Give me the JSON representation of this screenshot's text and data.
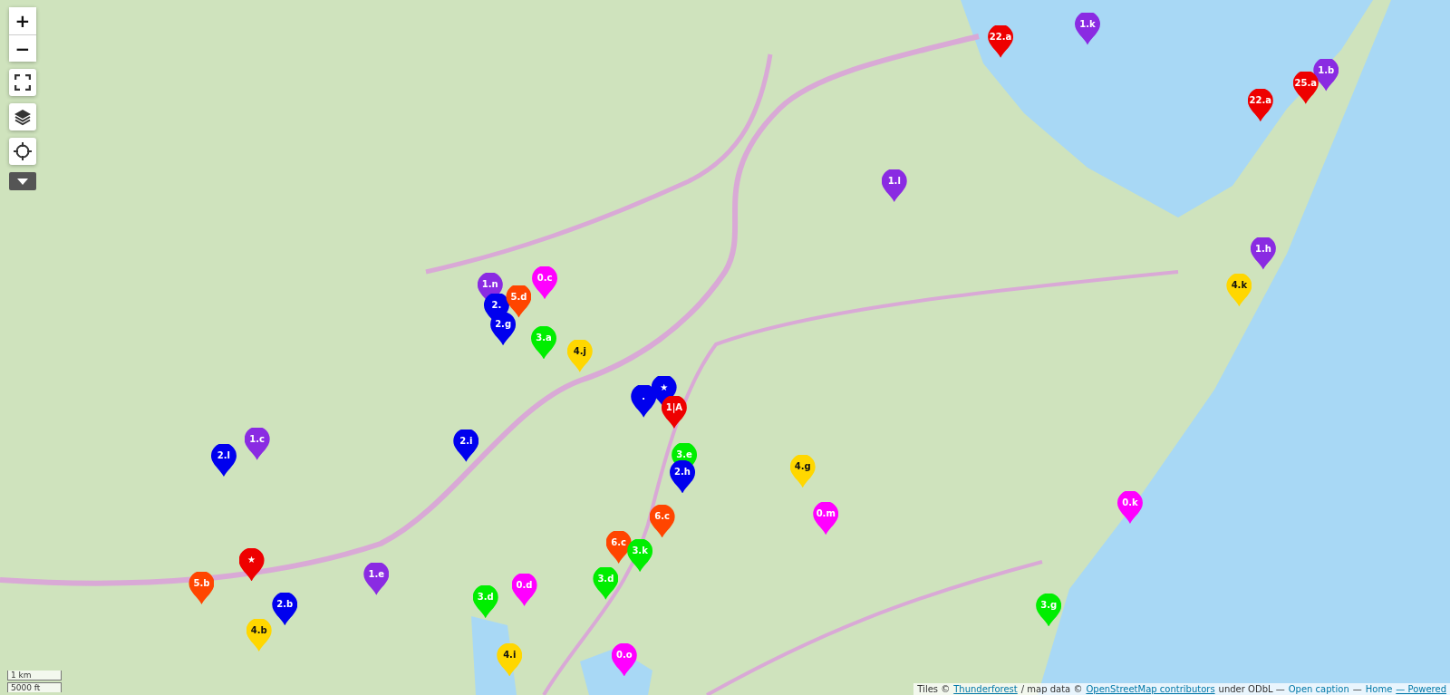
{
  "map_controls": {
    "zoom_in": "+",
    "zoom_out": "−"
  },
  "markers": [
    {
      "label": "1.k",
      "color": "#8a2be2"
    },
    {
      "label": "22.a",
      "color": "#ee0000"
    },
    {
      "label": "1.b",
      "color": "#8a2be2"
    },
    {
      "label": "25.a",
      "color": "#ee0000"
    },
    {
      "label": "22.a",
      "color": "#ee0000"
    },
    {
      "label": "1.l",
      "color": "#8a2be2"
    },
    {
      "label": "1.h",
      "color": "#8a2be2"
    },
    {
      "label": "4.k",
      "color": "#ffd700"
    },
    {
      "label": "1.n",
      "color": "#8a2be2"
    },
    {
      "label": "0.c",
      "color": "#ff00ff"
    },
    {
      "label": "2.",
      "color": "#0000ee"
    },
    {
      "label": "5.d",
      "color": "#ff4500"
    },
    {
      "label": "2.g",
      "color": "#0000ee"
    },
    {
      "label": "3.a",
      "color": "#00ee00"
    },
    {
      "label": "4.j",
      "color": "#ffd700"
    },
    {
      "label": ".",
      "color": "#0000ee"
    },
    {
      "label": "★",
      "color": "#0000ee"
    },
    {
      "label": "1|A",
      "color": "#ee0000"
    },
    {
      "label": "2.i",
      "color": "#0000ee"
    },
    {
      "label": "1.c",
      "color": "#8a2be2"
    },
    {
      "label": "2.l",
      "color": "#0000ee"
    },
    {
      "label": "3.e",
      "color": "#00ee00"
    },
    {
      "label": "2.h",
      "color": "#0000ee"
    },
    {
      "label": "4.g",
      "color": "#ffd700"
    },
    {
      "label": "6.c",
      "color": "#ff4500"
    },
    {
      "label": "0.m",
      "color": "#ff00ff"
    },
    {
      "label": "0.k",
      "color": "#ff00ff"
    },
    {
      "label": "6.c",
      "color": "#ff4500"
    },
    {
      "label": "3.k",
      "color": "#00ee00"
    },
    {
      "label": "★",
      "color": "#ee0000"
    },
    {
      "label": "1.e",
      "color": "#8a2be2"
    },
    {
      "label": "3.d",
      "color": "#00ee00"
    },
    {
      "label": "5.b",
      "color": "#ff4500"
    },
    {
      "label": "0.d",
      "color": "#ff00ff"
    },
    {
      "label": "3.d",
      "color": "#00ee00"
    },
    {
      "label": "2.b",
      "color": "#0000ee"
    },
    {
      "label": "3.g",
      "color": "#00ee00"
    },
    {
      "label": "4.b",
      "color": "#ffd700"
    },
    {
      "label": "4.i",
      "color": "#ffd700"
    },
    {
      "label": "0.o",
      "color": "#ff00ff"
    }
  ],
  "scale": [
    "1 km",
    "5000 ft"
  ],
  "attribution": [
    {
      "kind": "text",
      "text": "Tiles ©"
    },
    {
      "kind": "link",
      "text": "Thunderforest"
    },
    {
      "kind": "text",
      "text": "/ map data ©"
    },
    {
      "kind": "link",
      "text": "OpenStreetMap contributors"
    },
    {
      "kind": "text",
      "text": "under ODbL —"
    },
    {
      "kind": "plain-link",
      "text": "Open caption"
    },
    {
      "kind": "text",
      "text": "—"
    },
    {
      "kind": "plain-link",
      "text": "Home"
    },
    {
      "kind": "link",
      "text": "— Powered"
    }
  ]
}
